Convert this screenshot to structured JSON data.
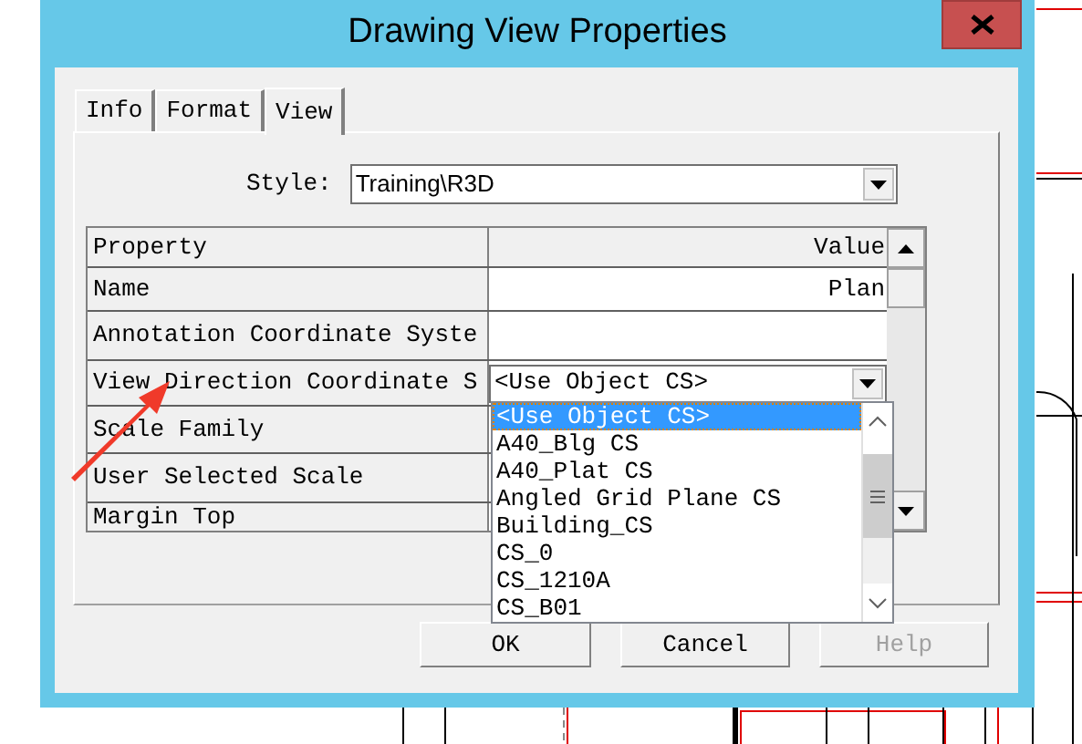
{
  "window": {
    "title": "Drawing View Properties"
  },
  "tabs": [
    {
      "label": "Info",
      "selected": false
    },
    {
      "label": "Format",
      "selected": false
    },
    {
      "label": "View",
      "selected": true
    }
  ],
  "style": {
    "label": "Style:",
    "value": "Training\\R3D"
  },
  "grid": {
    "columns": [
      "Property",
      "Value"
    ],
    "rows": [
      {
        "property": "Name",
        "kind": "text",
        "value": "Plan"
      },
      {
        "property": "Annotation Coordinate Syste",
        "kind": "text"
      },
      {
        "property": "View Direction Coordinate S",
        "kind": "combo",
        "value": "<Use Object CS>"
      },
      {
        "property": "Scale Family",
        "kind": "text"
      },
      {
        "property": "User Selected Scale",
        "kind": "text"
      },
      {
        "property": "Margin Top",
        "kind": "text"
      }
    ]
  },
  "dropdown": {
    "items": [
      {
        "label": "<Use Object CS>",
        "selected": true
      },
      {
        "label": "A40_Blg CS",
        "selected": false
      },
      {
        "label": "A40_Plat CS",
        "selected": false
      },
      {
        "label": "Angled Grid Plane CS",
        "selected": false
      },
      {
        "label": "Building_CS",
        "selected": false
      },
      {
        "label": "CS_0",
        "selected": false
      },
      {
        "label": "CS_1210A",
        "selected": false
      },
      {
        "label": "CS_B01",
        "selected": false
      }
    ]
  },
  "buttons": [
    {
      "label": "OK",
      "disabled": false
    },
    {
      "label": "Cancel",
      "disabled": false
    },
    {
      "label": "Help",
      "disabled": true
    }
  ]
}
